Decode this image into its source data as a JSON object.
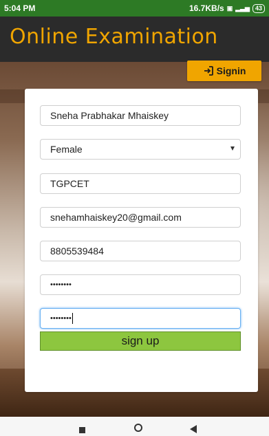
{
  "status_bar": {
    "time": "5:04 PM",
    "speed": "16.7KB/s",
    "battery": "43"
  },
  "header": {
    "title": "Online Examination"
  },
  "signin_button": {
    "label": "Signin",
    "icon": "sign-in-icon"
  },
  "form": {
    "name_value": "Sneha Prabhakar Mhaiskey",
    "gender_value": "Female",
    "college_value": "TGPCET",
    "email_value": "snehamhaiskey20@gmail.com",
    "phone_value": "8805539484",
    "password_mask": "••••••••",
    "confirm_mask": "••••••••"
  },
  "signup_button": {
    "label": "sign up"
  },
  "colors": {
    "status_bar": "#2d7a25",
    "header_bg": "#2b2b2b",
    "title": "#f0a500",
    "signin_bg": "#f0a500",
    "signup_bg": "#8dc63f"
  },
  "nav_bar": {
    "icons": [
      "recent-apps-icon",
      "home-icon",
      "back-icon"
    ]
  }
}
